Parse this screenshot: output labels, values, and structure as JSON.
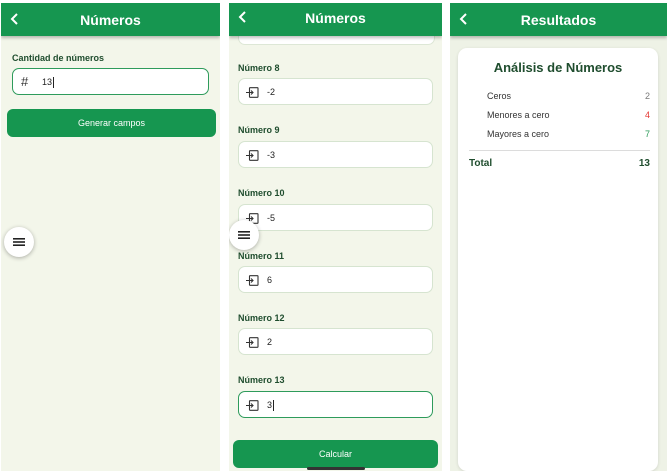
{
  "screen1": {
    "title": "Números",
    "count_label": "Cantidad de números",
    "count_icon": "#",
    "count_value": "13",
    "generate_label": "Generar campos"
  },
  "screen2": {
    "title": "Números",
    "fields": [
      {
        "label": "Número 8",
        "value": "-2"
      },
      {
        "label": "Número 9",
        "value": "-3"
      },
      {
        "label": "Número 10",
        "value": "-5"
      },
      {
        "label": "Número 11",
        "value": "6"
      },
      {
        "label": "Número 12",
        "value": "2"
      },
      {
        "label": "Número 13",
        "value": "3"
      }
    ],
    "calculate_label": "Calcular"
  },
  "screen3": {
    "title": "Resultados",
    "card_title": "Análisis de Números",
    "rows": [
      {
        "label": "Ceros",
        "value": "2",
        "color": "#7a7a7a"
      },
      {
        "label": "Menores a cero",
        "value": "4",
        "color": "#e53935"
      },
      {
        "label": "Mayores a cero",
        "value": "7",
        "color": "#2e9b5b"
      }
    ],
    "total_label": "Total",
    "total_value": "13"
  },
  "colors": {
    "primary": "#169650",
    "background": "#f3f6ea",
    "negative": "#e53935",
    "positive": "#2e9b5b"
  }
}
